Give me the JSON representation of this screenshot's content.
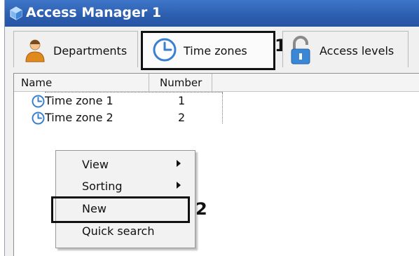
{
  "window": {
    "title": "Access Manager 1"
  },
  "tabs": [
    {
      "label": "Departments",
      "icon": "person-icon"
    },
    {
      "label": "Time zones",
      "icon": "clock-icon",
      "active": true
    },
    {
      "label": "Access levels",
      "icon": "padlock-icon"
    }
  ],
  "list": {
    "columns": [
      "Name",
      "Number"
    ],
    "rows": [
      {
        "name": "Time zone 1",
        "number": "1"
      },
      {
        "name": "Time zone 2",
        "number": "2"
      }
    ]
  },
  "context_menu": {
    "items": [
      {
        "label": "View",
        "submenu": true
      },
      {
        "label": "Sorting",
        "submenu": true
      },
      {
        "label": "New",
        "submenu": false
      },
      {
        "label": "Quick search",
        "submenu": false
      }
    ]
  },
  "callouts": {
    "tab_marker": "1",
    "menu_marker": "2"
  },
  "colors": {
    "titlebar": "#2d5fb0",
    "highlight_border": "#111111",
    "clock_blue": "#3a7fd0"
  }
}
